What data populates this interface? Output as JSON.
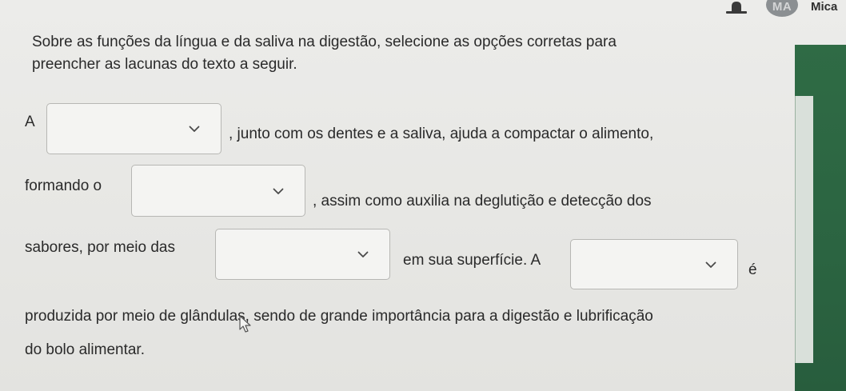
{
  "header": {
    "bell_icon": "bell-icon",
    "avatar_initials": "MA",
    "user_name": "Mica"
  },
  "question": {
    "intro_line1": "Sobre as funções da língua e da saliva na digestão, selecione as opções corretas para",
    "intro_line2": "preencher as lacunas do texto a seguir.",
    "seg_a": "A",
    "seg_b": ", junto com os dentes e a saliva, ajuda a compactar o alimento,",
    "seg_c": "formando o",
    "seg_d": ", assim como auxilia na deglutição e detecção dos",
    "seg_e": "sabores, por meio das",
    "seg_f": "em sua superfície. A",
    "seg_g": "é",
    "seg_h": "produzida por meio de glândulas, sendo de grande importância para a digestão e lubrificação",
    "seg_i": "do bolo alimentar."
  },
  "dropdowns": [
    {
      "id": 1,
      "selected": ""
    },
    {
      "id": 2,
      "selected": ""
    },
    {
      "id": 3,
      "selected": ""
    },
    {
      "id": 4,
      "selected": ""
    }
  ],
  "icons": {
    "dropdown_chevron": "chevron-down-icon",
    "pointer": "mouse-cursor-icon"
  },
  "colors": {
    "background": "#e9e9e6",
    "text": "#2a2a2a",
    "dropdown_border": "#b7b7b4",
    "avatar": "#8b8f92",
    "side_strip": "#2f6b45"
  }
}
